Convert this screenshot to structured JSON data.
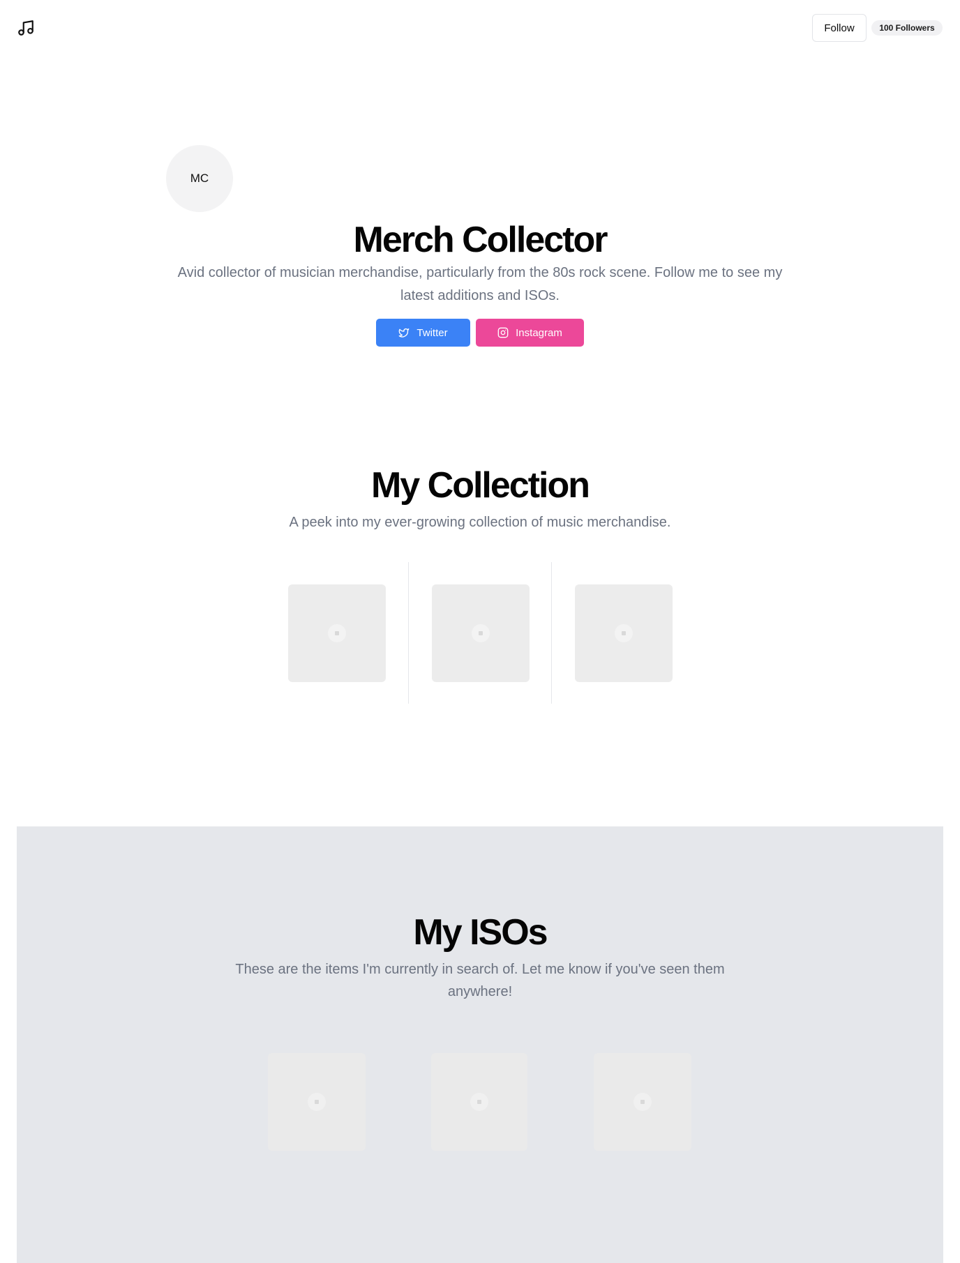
{
  "header": {
    "logo_icon": "music-note-icon",
    "follow_label": "Follow",
    "followers_label": "100 Followers"
  },
  "profile": {
    "avatar_initials": "MC",
    "name": "Merch Collector",
    "bio": "Avid collector of musician merchandise, particularly from the 80s rock scene. Follow me to see my latest additions and ISOs.",
    "social": [
      {
        "label": "Twitter",
        "icon": "twitter-icon",
        "color": "#3b82f6"
      },
      {
        "label": "Instagram",
        "icon": "instagram-icon",
        "color": "#ec4899"
      }
    ]
  },
  "collection": {
    "title": "My Collection",
    "subtitle": "A peek into my ever-growing collection of music merchandise."
  },
  "isos": {
    "title": "My ISOs",
    "subtitle": "These are the items I'm currently in search of. Let me know if you've seen them anywhere!"
  }
}
